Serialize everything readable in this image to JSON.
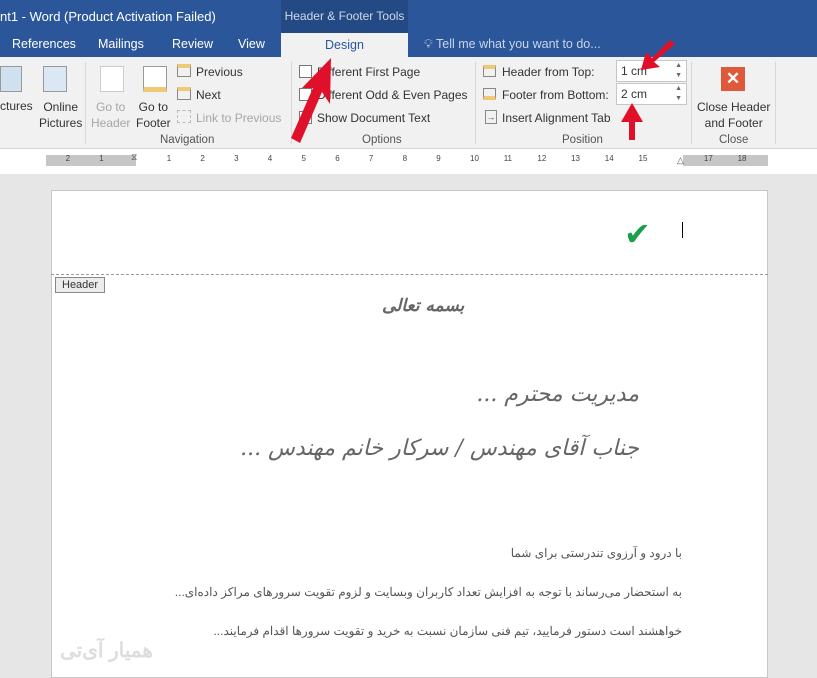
{
  "window": {
    "title": "nt1 - Word (Product Activation Failed)",
    "contextual_tab_group": "Header & Footer Tools"
  },
  "tabs": [
    {
      "label": "References"
    },
    {
      "label": "Mailings"
    },
    {
      "label": "Review"
    },
    {
      "label": "View"
    },
    {
      "label": "Design",
      "active": true
    }
  ],
  "tell_me": {
    "placeholder": "Tell me what you want to do..."
  },
  "ribbon": {
    "insert": {
      "pictures": "ctures",
      "online_pictures_1": "Online",
      "online_pictures_2": "Pictures"
    },
    "navigation": {
      "go_to_header_1": "Go to",
      "go_to_header_2": "Header",
      "go_to_footer_1": "Go to",
      "go_to_footer_2": "Footer",
      "previous": "Previous",
      "next": "Next",
      "link_to_previous": "Link to Previous",
      "group": "Navigation"
    },
    "options": {
      "different_first_page": "Different First Page",
      "different_odd_even": "Different Odd & Even Pages",
      "show_document_text": "Show Document Text",
      "group": "Options"
    },
    "position": {
      "header_from_top_label": "Header from Top:",
      "header_from_top_value": "1 cm",
      "footer_from_bottom_label": "Footer from Bottom:",
      "footer_from_bottom_value": "2 cm",
      "insert_alignment_tab": "Insert Alignment Tab",
      "group": "Position"
    },
    "close": {
      "label_1": "Close Header",
      "label_2": "and Footer",
      "group": "Close"
    }
  },
  "ruler": {
    "left_numbers": [
      "2",
      "1"
    ],
    "numbers": [
      "1",
      "2",
      "3",
      "4",
      "5",
      "6",
      "7",
      "8",
      "9",
      "10",
      "11",
      "12",
      "13",
      "14",
      "15"
    ],
    "right_numbers": [
      "17",
      "18"
    ]
  },
  "document": {
    "header_tag": "Header",
    "bismillah": "بسمه تعالی",
    "salutation_1": "مدیریت محترم ...",
    "salutation_2": "جناب آقای مهندس / سرکار خانم مهندس ...",
    "para_1": "با درود و آرزوی تندرستی برای شما",
    "para_2": "به استحضار می‌رساند با توجه به افزایش تعداد کاربران وبسایت و لزوم تقویت سرورهای مراکز داده‌ای...",
    "para_3": "خواهشند است دستور فرمایید، تیم فنی سازمان نسبت به خرید و تقویت سرورها اقدام فرمایند...",
    "watermark": "همیار آی‌تی"
  },
  "colors": {
    "accent": "#2b579a",
    "annotation_arrow": "#e0102a",
    "checkmark": "#1aa04a",
    "close_button": "#e0583a"
  }
}
